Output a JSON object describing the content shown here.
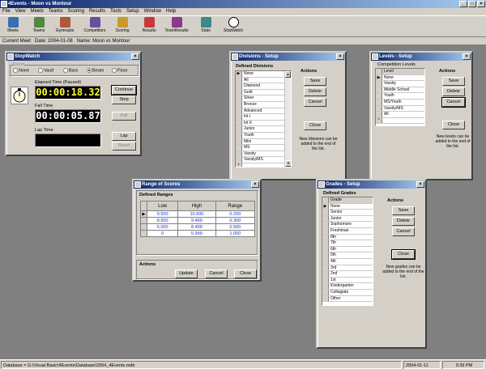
{
  "app": {
    "title": "4Events - Moon vs Montour",
    "colors": {
      "titlebar": "#0a246a",
      "desktop": "#808080",
      "face": "#d4d0c8",
      "digital": "#000000"
    }
  },
  "menu": [
    "File",
    "View",
    "Meets",
    "Teams",
    "Scoring",
    "Results",
    "Tools",
    "Setup",
    "Window",
    "Help"
  ],
  "toolbar": [
    {
      "label": "Meets",
      "icon": "meets-icon",
      "color": "#3a6fb0"
    },
    {
      "label": "Teams",
      "icon": "teams-icon",
      "color": "#4f8a3c"
    },
    {
      "label": "Gymnasts",
      "icon": "gymnasts-icon",
      "color": "#b05a3a"
    },
    {
      "label": "Competitors",
      "icon": "competitors-icon",
      "color": "#6a4fa0"
    },
    {
      "label": "Scoring",
      "icon": "scoring-icon",
      "color": "#c89a2a"
    },
    {
      "label": "Results",
      "icon": "results-icon",
      "color": "#c83a3a"
    },
    {
      "label": "TeamResults",
      "icon": "team-results-icon",
      "color": "#8a3a8a"
    },
    {
      "label": "Stats",
      "icon": "stats-icon",
      "color": "#3a8a8a"
    },
    {
      "label": "StopWatch",
      "icon": "stopwatch-icon",
      "color": "#ffffff"
    }
  ],
  "meet": {
    "label": "Current Meet",
    "date_label": "Date:",
    "date": "2004-01-08",
    "name_label": "Name:",
    "name": "Moon vs Montour"
  },
  "stopwatch": {
    "title": "StopWatch",
    "event_label": "Event",
    "events": [
      "None",
      "Vault",
      "Bars",
      "Beam",
      "Floor"
    ],
    "selected_event": "Beam",
    "elapsed_label": "Elapsed Time (Paused)",
    "elapsed": "00:00:18.32",
    "fall_label": "Fall Time",
    "fall": "00:00:05.87",
    "lap_label": "Lap Time",
    "lap": "",
    "buttons": {
      "continue": "Continue",
      "stop": "Stop",
      "fall": "Fall",
      "lap": "Lap",
      "reset": "Reset"
    }
  },
  "divisions": {
    "title": "Divisions - Setup",
    "list_label": "Defined Divisions",
    "items": [
      "None",
      "All",
      "Diamond",
      "Gold",
      "Silver",
      "Bronze",
      "Advanced",
      "Int I",
      "Int II",
      "Junior",
      "Youth",
      "Mini",
      "MS",
      "Varsity",
      "Varsity/MS",
      ""
    ],
    "actions_label": "Actions",
    "buttons": {
      "save": "Save",
      "delete": "Delete",
      "cancel": "Cancel",
      "close": "Close"
    },
    "note": "New divisions can be added to the end of the list."
  },
  "levels": {
    "title": "Levels - Setup",
    "list_label": "Competition Levels",
    "header": "Level",
    "items": [
      "None",
      "Varsity",
      "Middle School",
      "Youth",
      "MS/Youth",
      "Varsity/MS",
      "All",
      ""
    ],
    "actions_label": "Actions",
    "buttons": {
      "save": "Save",
      "delete": "Delete",
      "cancel": "Cancel",
      "close": "Close"
    },
    "note": "New levels can be added to the end of the list."
  },
  "ranges": {
    "title": "Range of Scores",
    "group_label": "Defined Ranges",
    "columns": [
      "Low",
      "High",
      "Range"
    ],
    "rows": [
      [
        "9.500",
        "10.000",
        "0.200"
      ],
      [
        "8.500",
        "9.499",
        "0.300"
      ],
      [
        "6.000",
        "8.499",
        "0.500"
      ],
      [
        "0",
        "5.999",
        "1.000"
      ]
    ],
    "actions_label": "Actions",
    "buttons": {
      "update": "Update",
      "cancel": "Cancel",
      "close": "Close"
    }
  },
  "grades": {
    "title": "Grades - Setup",
    "list_label": "Defined Grades",
    "header": "Grade",
    "items": [
      "None",
      "Senior",
      "Junior",
      "Sophomore",
      "Freshman",
      "8th",
      "7th",
      "6th",
      "5th",
      "4th",
      "3rd",
      "2nd",
      "1st",
      "Kindergarten",
      "Collegiate",
      "Other"
    ],
    "actions_label": "Actions",
    "buttons": {
      "save": "Save",
      "delete": "Delete",
      "cancel": "Cancel",
      "close": "Close"
    },
    "note": "New grades can be added to the end of the list."
  },
  "status": {
    "database": "Database = G:\\Visual Basic\\4Events\\Database\\2004_4Events.mdb",
    "date": "2004-01-11",
    "time": "9:39 PM"
  }
}
